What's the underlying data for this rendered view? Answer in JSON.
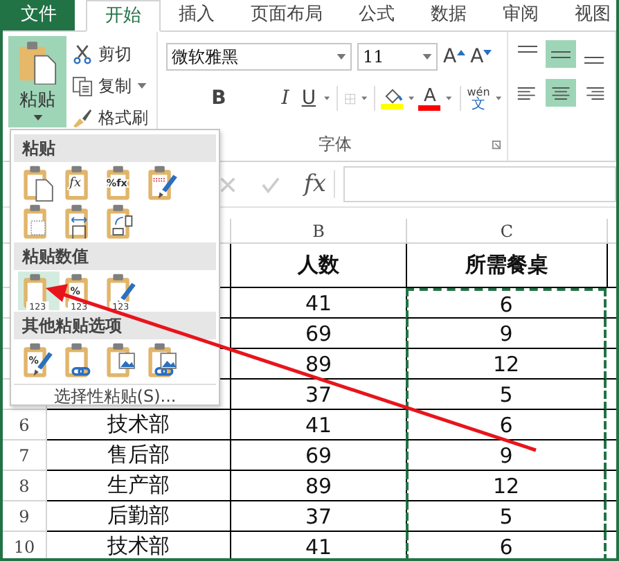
{
  "tabs": [
    {
      "label": "文件",
      "kind": "file",
      "selected": false
    },
    {
      "label": "开始",
      "kind": "tab",
      "selected": true
    },
    {
      "label": "插入",
      "kind": "tab",
      "selected": false
    },
    {
      "label": "页面布局",
      "kind": "tab",
      "selected": false
    },
    {
      "label": "公式",
      "kind": "tab",
      "selected": false
    },
    {
      "label": "数据",
      "kind": "tab",
      "selected": false
    },
    {
      "label": "审阅",
      "kind": "tab",
      "selected": false
    },
    {
      "label": "视图",
      "kind": "tab",
      "selected": false
    }
  ],
  "ribbon": {
    "clipboard": {
      "paste": {
        "label": "粘贴",
        "expanded": true
      },
      "cut": "剪切",
      "copy": "复制",
      "format_painter": "格式刷"
    },
    "font": {
      "name": "微软雅黑",
      "size": "11",
      "grow": "A",
      "shrink": "A",
      "bold": "B",
      "italic": "I",
      "underline": "U",
      "font_color_letter": "A",
      "phonetic": "wén",
      "phonetic_char": "文",
      "group_label": "字体"
    },
    "alignment": {
      "vertical": [
        {
          "kind": "top",
          "selected": false
        },
        {
          "kind": "middle",
          "selected": true
        },
        {
          "kind": "bottom",
          "selected": false
        }
      ],
      "horizontal": [
        {
          "kind": "left",
          "selected": false
        },
        {
          "kind": "center",
          "selected": true
        },
        {
          "kind": "right",
          "selected": false
        }
      ]
    }
  },
  "formula_bar": {
    "fx": "fx"
  },
  "sheet": {
    "columns": [
      {
        "label": "B",
        "copied": false
      },
      {
        "label": "C",
        "copied": true
      }
    ],
    "rows": [
      {
        "header": true,
        "cells": [
          "人数",
          "所需餐桌"
        ]
      },
      {
        "cells": [
          "41",
          "6"
        ]
      },
      {
        "cells": [
          "69",
          "9"
        ]
      },
      {
        "cells": [
          "89",
          "12"
        ]
      },
      {
        "cells": [
          "37",
          "5"
        ]
      },
      {
        "number": "6",
        "name": "技术部",
        "cells": [
          "41",
          "6"
        ]
      },
      {
        "number": "7",
        "name": "售后部",
        "cells": [
          "69",
          "9"
        ]
      },
      {
        "number": "8",
        "name": "生产部",
        "cells": [
          "89",
          "12"
        ]
      },
      {
        "number": "9",
        "name": "后勤部",
        "cells": [
          "37",
          "5"
        ]
      },
      {
        "number": "10",
        "name": "技术部",
        "cells": [
          "41",
          "6"
        ]
      }
    ]
  },
  "paste_menu": {
    "sections": [
      {
        "title": "粘贴",
        "options": [
          {
            "kind": "paste",
            "selected": false
          },
          {
            "kind": "formulas",
            "sign": "fx",
            "selected": false
          },
          {
            "kind": "formulas_number",
            "sign": "%fx",
            "selected": false
          },
          {
            "kind": "keep_source",
            "selected": false
          },
          {
            "kind": "no_borders",
            "selected": false
          },
          {
            "kind": "keep_widths",
            "selected": false
          },
          {
            "kind": "transpose",
            "selected": false
          }
        ]
      },
      {
        "title": "粘贴数值",
        "options": [
          {
            "kind": "values",
            "badge": "123",
            "selected": true
          },
          {
            "kind": "values_number",
            "sign": "%",
            "badge": "123",
            "selected": false
          },
          {
            "kind": "values_source",
            "badge": "123",
            "selected": false
          }
        ]
      },
      {
        "title": "其他粘贴选项",
        "options": [
          {
            "kind": "formatting",
            "sign": "%",
            "selected": false
          },
          {
            "kind": "link",
            "selected": false
          },
          {
            "kind": "picture",
            "selected": false
          },
          {
            "kind": "linked_picture",
            "selected": false
          }
        ]
      }
    ],
    "footer": "选择性粘贴(S)..."
  }
}
